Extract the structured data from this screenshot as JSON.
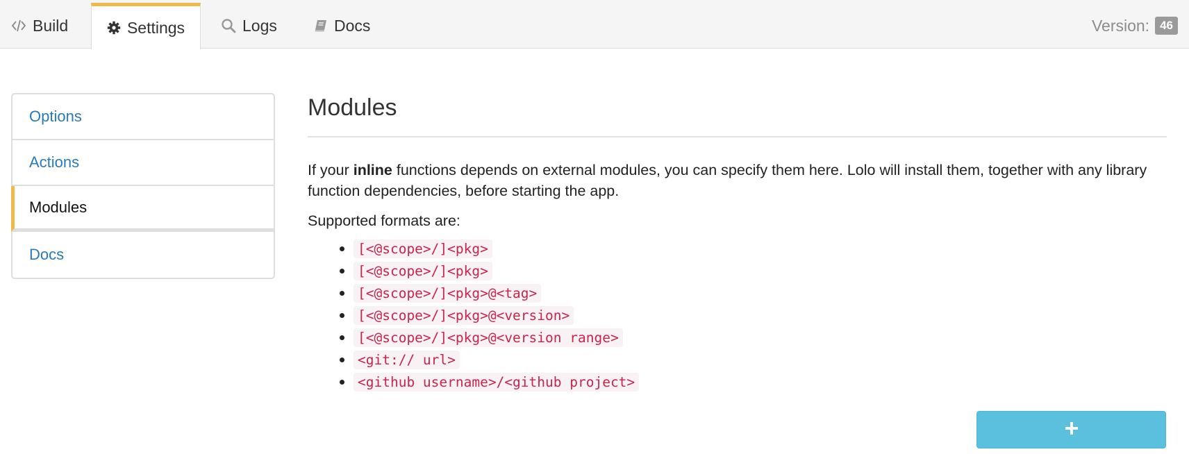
{
  "nav": {
    "tabs": [
      {
        "label": "Build",
        "icon": "code-icon"
      },
      {
        "label": "Settings",
        "icon": "gear-icon"
      },
      {
        "label": "Logs",
        "icon": "search-icon"
      },
      {
        "label": "Docs",
        "icon": "book-icon"
      }
    ],
    "active_tab": "Settings",
    "version_label": "Version:",
    "version_value": "46",
    "accent_color": "#f0b94a"
  },
  "sidebar": {
    "items": [
      {
        "label": "Options"
      },
      {
        "label": "Actions"
      },
      {
        "label": "Modules"
      },
      {
        "label": "Docs"
      }
    ],
    "active_item": "Modules"
  },
  "main": {
    "title": "Modules",
    "description_pre": "If your ",
    "description_bold": "inline",
    "description_post": " functions depends on external modules, you can specify them here. Lolo will install them, together with any library function dependencies, before starting the app.",
    "formats_title": "Supported formats are:",
    "formats": [
      "[<@scope>/]<pkg>",
      "[<@scope>/]<pkg>",
      "[<@scope>/]<pkg>@<tag>",
      "[<@scope>/]<pkg>@<version>",
      "[<@scope>/]<pkg>@<version range>",
      "<git:// url>",
      "<github username>/<github project>"
    ],
    "add_button": {
      "label": "+",
      "color": "#5bc0de"
    }
  }
}
